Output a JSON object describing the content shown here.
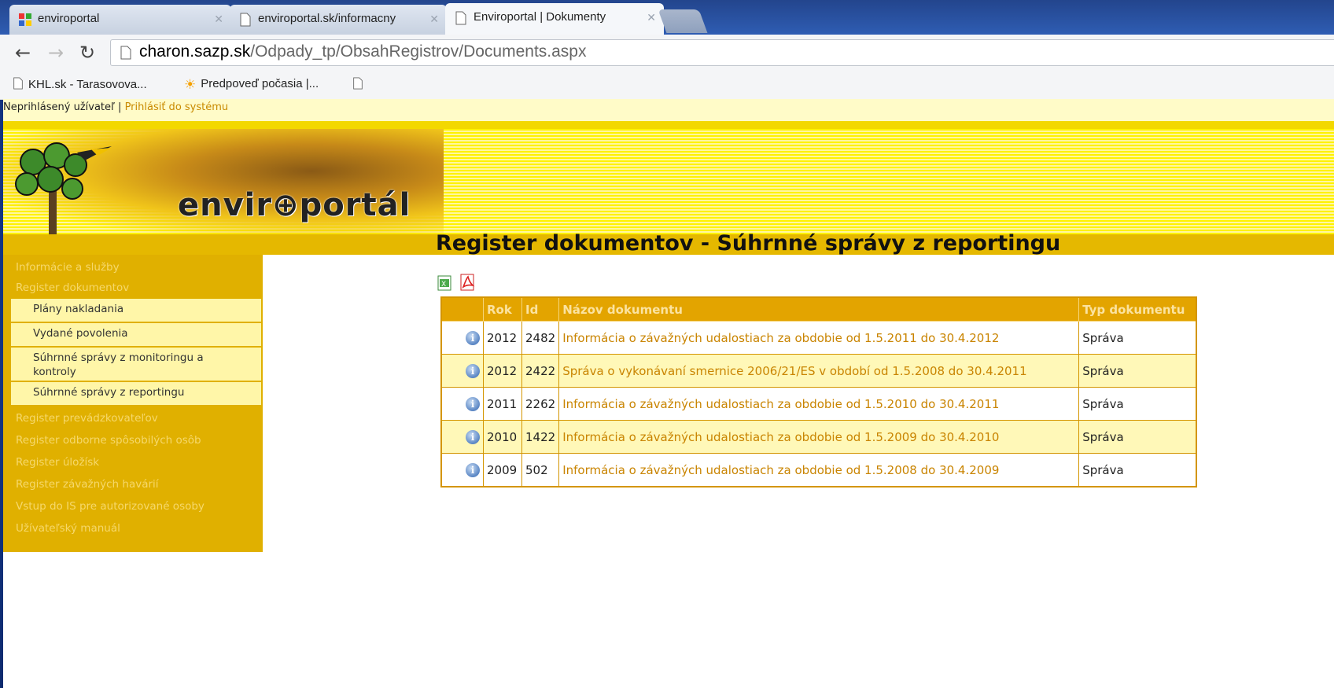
{
  "browser": {
    "tabs": [
      {
        "title": "enviroportal",
        "icon": "app-icon",
        "active": false
      },
      {
        "title": "enviroportal.sk/informacny",
        "icon": "page-icon",
        "active": false
      },
      {
        "title": "Enviroportal | Dokumenty",
        "icon": "page-icon",
        "active": true
      }
    ],
    "url_host": "charon.sazp.sk",
    "url_path": "/Odpady_tp/ObsahRegistrov/Documents.aspx",
    "bookmarks": [
      {
        "label": "KHL.sk - Tarasovova...",
        "icon": "page-icon"
      },
      {
        "label": "Predpoveď počasia |...",
        "icon": "sun-icon"
      },
      {
        "label": "",
        "icon": "page-icon"
      }
    ]
  },
  "login": {
    "status": "Neprihlásený užívateľ",
    "separator": "|",
    "login_link": "Prihlásiť do systému"
  },
  "logo": {
    "text": "envir⊕portál"
  },
  "sidebar": {
    "items_top": [
      "Informácie a služby",
      "Register dokumentov"
    ],
    "sub_items": [
      "Plány nakladania",
      "Vydané povolenia",
      "Súhrnné správy z monitoringu a kontroly",
      "Súhrnné správy z reportingu"
    ],
    "items_bottom": [
      "Register prevádzkovateľov",
      "Register odborne spôsobilých osôb",
      "Register úložísk",
      "Register závažných havárií",
      "Vstup do IS pre autorizované osoby",
      "Užívateľský manuál"
    ]
  },
  "main": {
    "title": "Register dokumentov - Súhrnné správy z reportingu",
    "table": {
      "headers": [
        "",
        "Rok",
        "Id",
        "Názov dokumentu",
        "Typ dokumentu"
      ],
      "rows": [
        {
          "year": "2012",
          "id": "2482",
          "name": "Informácia o závažných udalostiach za obdobie od 1.5.2011 do 30.4.2012",
          "type": "Správa"
        },
        {
          "year": "2012",
          "id": "2422",
          "name": "Správa o vykonávaní smernice 2006/21/ES v období od 1.5.2008 do 30.4.2011",
          "type": "Správa"
        },
        {
          "year": "2011",
          "id": "2262",
          "name": "Informácia o závažných udalostiach za obdobie od 1.5.2010 do 30.4.2011",
          "type": "Správa"
        },
        {
          "year": "2010",
          "id": "1422",
          "name": "Informácia o závažných udalostiach za obdobie od 1.5.2009 do 30.4.2010",
          "type": "Správa"
        },
        {
          "year": "2009",
          "id": "502",
          "name": "Informácia o závažných udalostiach za obdobie od 1.5.2008 do 30.4.2009",
          "type": "Správa"
        }
      ]
    }
  },
  "colors": {
    "sidebar": "#e0b000",
    "table_header": "#e3a400",
    "link": "#c98400",
    "banner": "#fff200"
  }
}
